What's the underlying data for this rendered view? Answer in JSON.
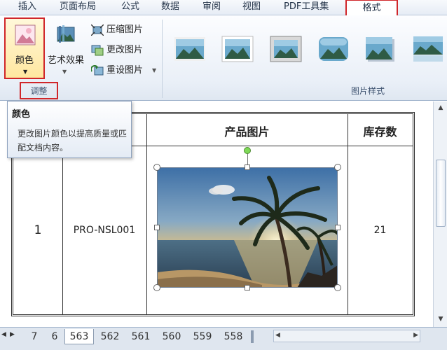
{
  "tabs": [
    {
      "label": "插入"
    },
    {
      "label": "页面布局"
    },
    {
      "label": "公式"
    },
    {
      "label": "数据"
    },
    {
      "label": "审阅"
    },
    {
      "label": "视图"
    },
    {
      "label": "PDF工具集"
    },
    {
      "label": "格式"
    }
  ],
  "ribbon": {
    "color_button": "颜色",
    "art_effects_button": "艺术效果",
    "compress_button": "压缩图片",
    "change_button": "更改图片",
    "reset_button": "重设图片",
    "adjust_group_label": "调整",
    "picture_styles_group_label": "图片样式"
  },
  "tooltip": {
    "title": "颜色",
    "body": "更改图片颜色以提高质量或匹配文档内容。"
  },
  "table": {
    "headers": {
      "picture": "产品图片",
      "stock": "库存数"
    },
    "row": {
      "index": "1",
      "code": "PRO-NSL001",
      "stock": "21"
    }
  },
  "sheet_tabs": [
    "7",
    "6",
    "563",
    "562",
    "561",
    "560",
    "559",
    "558"
  ],
  "active_sheet": "563",
  "colors": {
    "highlight_red": "#d0262a",
    "ribbon_bg": "#e9eff7"
  }
}
